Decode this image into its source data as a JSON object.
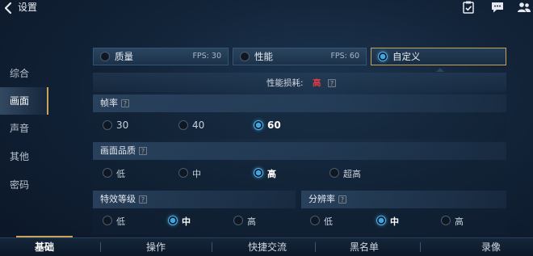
{
  "header": {
    "title": "设置",
    "icons": [
      "back-arrow",
      "clipboard-check",
      "chat",
      "friends"
    ]
  },
  "sidebar": {
    "items": [
      {
        "label": "综合"
      },
      {
        "label": "画面",
        "active": true
      },
      {
        "label": "声音"
      },
      {
        "label": "其他"
      },
      {
        "label": "密码"
      }
    ]
  },
  "presets": [
    {
      "label": "质量",
      "fps": "FPS: 30"
    },
    {
      "label": "性能",
      "fps": "FPS: 60"
    },
    {
      "label": "自定义",
      "fps": "",
      "selected": true
    }
  ],
  "performance": {
    "label": "性能损耗:",
    "value": "高"
  },
  "framerate": {
    "title": "帧率",
    "options": [
      "30",
      "40",
      "60"
    ],
    "selected": "60"
  },
  "quality": {
    "title": "画面品质",
    "options": [
      "低",
      "中",
      "高",
      "超高"
    ],
    "selected": "高"
  },
  "effects": {
    "title": "特效等级",
    "options": [
      "低",
      "中",
      "高"
    ],
    "selected": "中"
  },
  "resolution": {
    "title": "分辨率",
    "options": [
      "低",
      "中",
      "高"
    ],
    "selected": "中"
  },
  "bottom_tabs": [
    {
      "label": "基础",
      "active": true
    },
    {
      "label": "操作"
    },
    {
      "label": "快捷交流"
    },
    {
      "label": "黑名单"
    },
    {
      "label": "录像"
    }
  ],
  "colors": {
    "accent_gold": "#c9a55a",
    "radio_blue": "#3aa7e8",
    "perf_red": "#e23a44"
  }
}
